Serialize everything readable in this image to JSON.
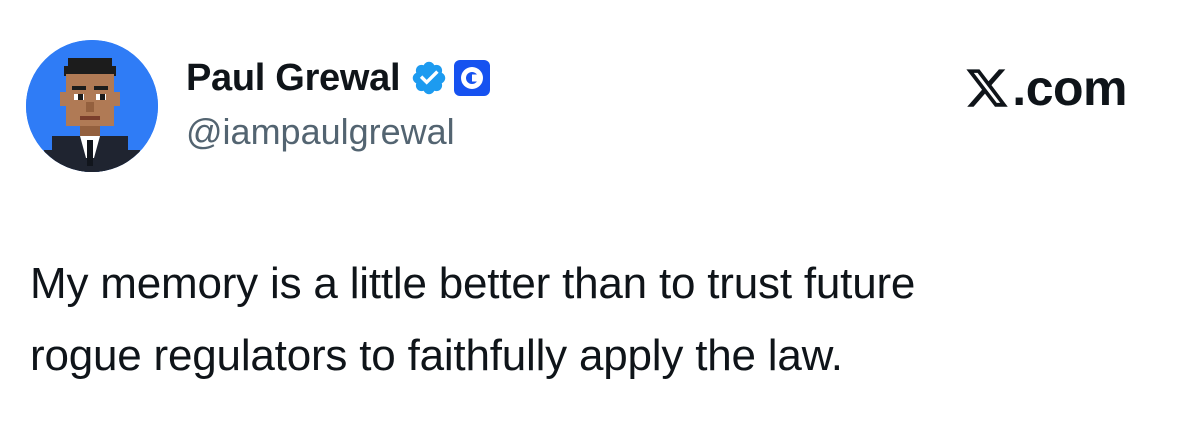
{
  "author": {
    "display_name": "Paul Grewal",
    "handle": "@iampaulgrewal",
    "avatar_icon": "pixel-art-avatar-icon",
    "verified_icon": "verified-badge-icon",
    "affiliate_icon": "coinbase-logo-icon",
    "avatar_bg_color": "#2f7cf6",
    "verified_color": "#1d9bf0",
    "affiliate_color": "#1652f0"
  },
  "brand": {
    "domain": ".com",
    "logo_icon": "x-logo-icon"
  },
  "tweet": {
    "lines": [
      "My memory is a little better than to trust future",
      "rogue regulators to faithfully apply the law."
    ]
  }
}
